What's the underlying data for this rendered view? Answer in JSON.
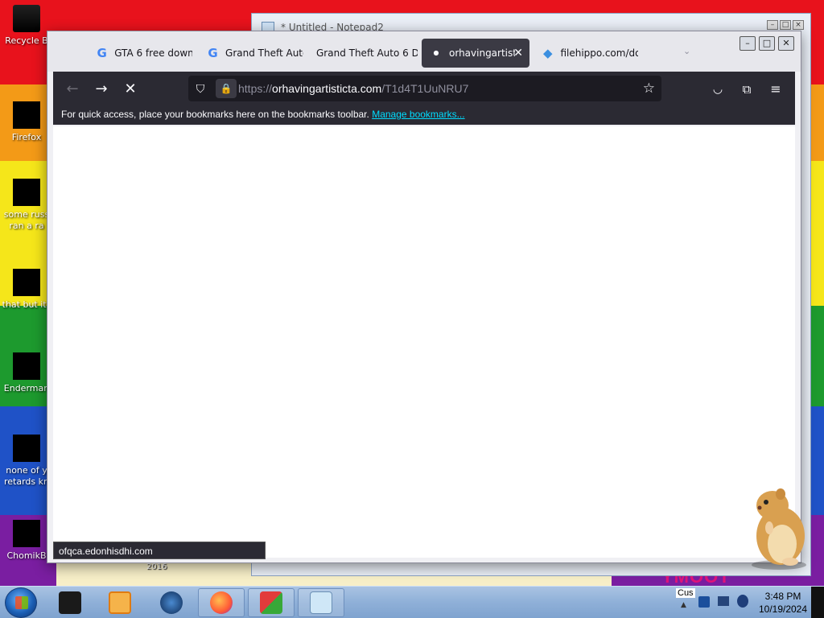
{
  "desktop": {
    "icons": [
      {
        "label": "Recycle B"
      },
      {
        "label": "Firefox"
      },
      {
        "label": "some russ ran a ra"
      },
      {
        "label": "that but its"
      },
      {
        "label": "Enderman"
      },
      {
        "label": "none of y retards kn"
      },
      {
        "label": "ChomikB"
      }
    ],
    "wallpaper_text": "2016",
    "wallpaper_text2": "YMOOT"
  },
  "notepad": {
    "title": "* Untitled - Notepad2"
  },
  "browser": {
    "tabs": [
      {
        "label": "GTA 6 free downl",
        "favicon": "google-icon"
      },
      {
        "label": "Grand Theft Auto",
        "favicon": "google-icon"
      },
      {
        "label": "Grand Theft Auto 6 Do",
        "favicon": "none"
      },
      {
        "label": "orhavingartisti",
        "favicon": "dot-icon",
        "active": true
      },
      {
        "label": "filehippo.com/do",
        "favicon": "hippo-icon"
      }
    ],
    "url": {
      "prefix": "https://",
      "domain": "orhavingartisticta.com",
      "path": "/T1d4T1UuNRU7"
    },
    "bookmark_hint": "For quick access, place your bookmarks here on the bookmarks toolbar.",
    "bookmark_link": "Manage bookmarks...",
    "status_url": "ofqca.edonhisdhi.com",
    "colors": {
      "toolbar": "#2b2a33",
      "link": "#00ddff",
      "active_tab": "#3b3a44"
    }
  },
  "taskbar": {
    "clock_time": "3:48 PM",
    "clock_date": "10/19/2024",
    "tray_label": "Cus"
  }
}
